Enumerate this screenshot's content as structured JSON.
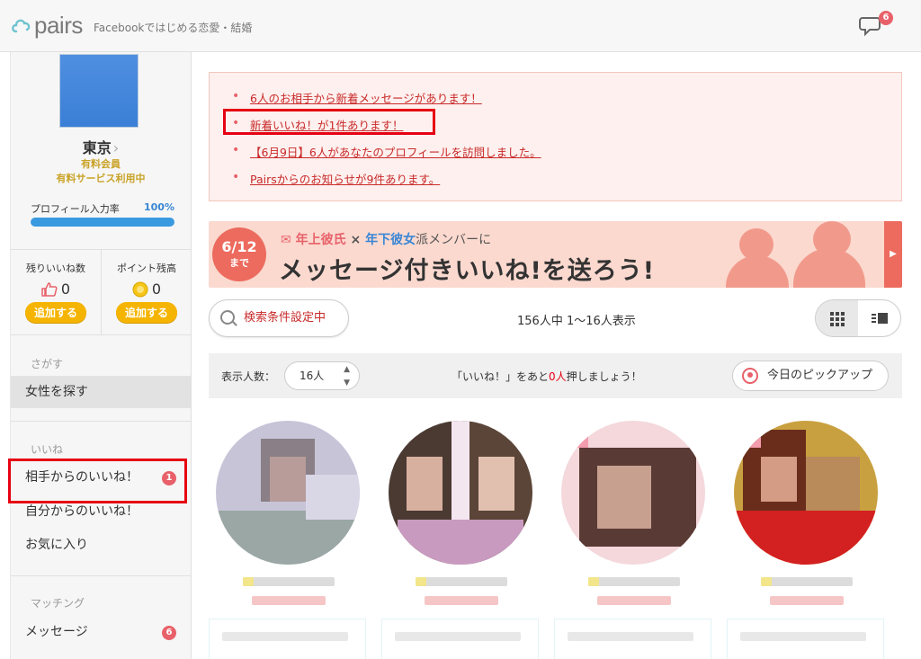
{
  "header": {
    "logo_text": "pairs",
    "tagline": "Facebookではじめる恋愛・結婚",
    "notification_count": "6"
  },
  "sidebar": {
    "location": "東京",
    "member_status_1": "有料会員",
    "member_status_2": "有料サービス利用中",
    "profile_label": "プロフィール入力率",
    "profile_percent": "100%",
    "profile_fill": 1.0,
    "likes_remaining_label": "残りいいね数",
    "likes_remaining_value": "0",
    "points_label": "ポイント残高",
    "points_value": "0",
    "add_button_label": "追加する",
    "sections": {
      "search": "さがす",
      "likes": "いいね",
      "matching": "マッチング"
    },
    "items": {
      "find_women": "女性を探す",
      "likes_received": "相手からのいいね！",
      "likes_received_badge": "1",
      "likes_sent": "自分からのいいね！",
      "favorites": "お気に入り",
      "messages": "メッセージ",
      "messages_badge": "6"
    }
  },
  "alerts": [
    "6人のお相手から新着メッセージがあります！",
    "新着いいね！が1件あります！",
    "【6月9日】6人があなたのプロフィールを訪問しました。",
    "Pairsからのお知らせが9件あります。"
  ],
  "banner": {
    "date": "6/12",
    "date_sub": "まで",
    "line1_a": "年上彼氏",
    "line1_x": "×",
    "line1_b": "年下彼女",
    "line1_c": "派メンバーに",
    "main": "メッセージ付きいいね!を送ろう!"
  },
  "search": {
    "button_label": "検索条件設定中",
    "result_count": "156人中 1〜16人表示"
  },
  "toolbar": {
    "display_label": "表示人数：",
    "display_value": "16人",
    "message_pre": "「いいね！」をあと",
    "message_num": "0人",
    "message_post": "押しましょう！",
    "pickup_label": "今日のピックアップ"
  },
  "colors": {
    "accent_red": "#e8616a",
    "alert_text": "#c82a2a",
    "gold": "#f5b400",
    "highlight_box": "#e60012"
  }
}
